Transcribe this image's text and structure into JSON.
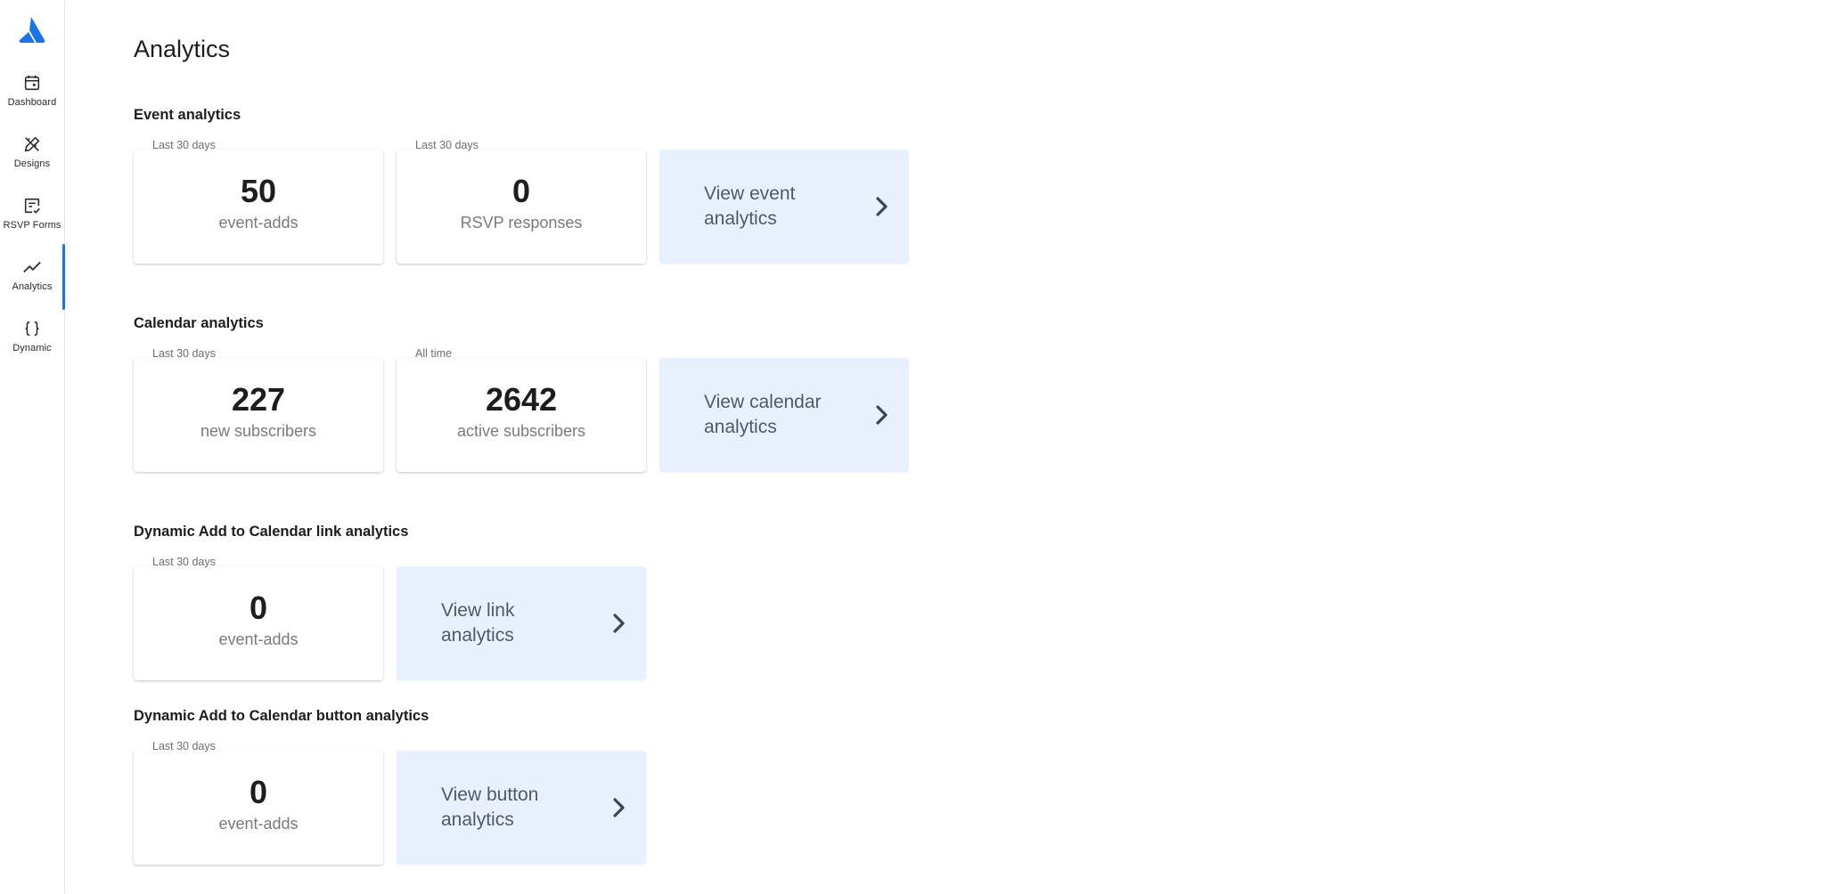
{
  "sidebar": {
    "items": [
      {
        "label": "Dashboard",
        "icon": "calendar-icon"
      },
      {
        "label": "Designs",
        "icon": "pencil-ruler-icon"
      },
      {
        "label": "RSVP Forms",
        "icon": "form-check-icon"
      },
      {
        "label": "Analytics",
        "icon": "trend-line-icon",
        "active": true
      },
      {
        "label": "Dynamic",
        "icon": "curly-braces-icon"
      }
    ]
  },
  "page": {
    "title": "Analytics"
  },
  "sections": {
    "event": {
      "title": "Event analytics",
      "cards": [
        {
          "period": "Last 30 days",
          "value": "50",
          "label": "event-adds"
        },
        {
          "period": "Last 30 days",
          "value": "0",
          "label": "RSVP responses"
        }
      ],
      "link": "View event analytics"
    },
    "calendar": {
      "title": "Calendar analytics",
      "cards": [
        {
          "period": "Last 30 days",
          "value": "227",
          "label": "new subscribers"
        },
        {
          "period": "All time",
          "value": "2642",
          "label": "active subscribers"
        }
      ],
      "link": "View calendar analytics"
    },
    "dyn_link": {
      "title": "Dynamic Add to Calendar link analytics",
      "cards": [
        {
          "period": "Last 30 days",
          "value": "0",
          "label": "event-adds"
        }
      ],
      "link": "View link analytics"
    },
    "dyn_button": {
      "title": "Dynamic Add to Calendar button analytics",
      "cards": [
        {
          "period": "Last 30 days",
          "value": "0",
          "label": "event-adds"
        }
      ],
      "link": "View button analytics"
    }
  },
  "colors": {
    "accent": "#1a73e8",
    "link_card_bg": "#e8f0fe",
    "muted_text": "#7a7a7a"
  }
}
